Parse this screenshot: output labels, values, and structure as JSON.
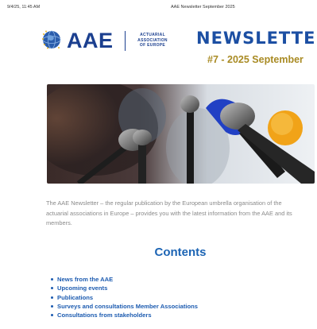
{
  "print_header": {
    "datetime": "9/4/25, 11:45 AM",
    "doc_title": "AAE Newsletter September 2025"
  },
  "logo": {
    "acronym": "AAE",
    "line1": "ACTUARIAL",
    "line2": "ASSOCIATION",
    "line3": "OF EUROPE"
  },
  "newsletter": {
    "title": "NEWSLETTER",
    "issue": "#7 - 2025 September"
  },
  "intro": "The AAE Newsletter – the regular publication by the European umbrella organisation of the actuarial associations in Europe – provides you with the latest information from the AAE and its members.",
  "contents": {
    "title": "Contents",
    "items": [
      "News from the AAE",
      "Upcoming events",
      "Publications",
      "Surveys and consultations Member Associations",
      "Consultations from stakeholders"
    ]
  },
  "colors": {
    "brand_blue": "#1b3f8f",
    "link_blue": "#1c5bb0",
    "gold": "#a98b24"
  }
}
